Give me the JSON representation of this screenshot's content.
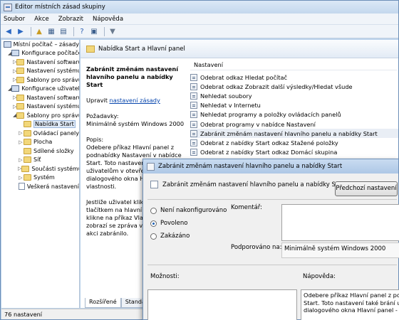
{
  "window": {
    "title": "Editor místních zásad skupiny"
  },
  "menu": [
    "Soubor",
    "Akce",
    "Zobrazit",
    "Nápověda"
  ],
  "tree": [
    {
      "label": "Místní počítač – zásady",
      "icon": "computer-policy-icon",
      "indent": 0,
      "expander": ""
    },
    {
      "label": "Konfigurace počítače",
      "icon": "computer-icon",
      "indent": 1,
      "expander": "◢"
    },
    {
      "label": "Nastavení softwaru",
      "icon": "folder-icon",
      "indent": 2,
      "expander": "▷"
    },
    {
      "label": "Nastavení systému",
      "icon": "folder-icon",
      "indent": 2,
      "expander": "▷"
    },
    {
      "label": "Šablony pro správu",
      "icon": "folder-icon",
      "indent": 2,
      "expander": "▷"
    },
    {
      "label": "Konfigurace uživatele",
      "icon": "computer-icon",
      "indent": 1,
      "expander": "◢"
    },
    {
      "label": "Nastavení softwaru",
      "icon": "folder-icon",
      "indent": 2,
      "expander": "▷"
    },
    {
      "label": "Nastavení systému",
      "icon": "folder-icon",
      "indent": 2,
      "expander": "▷"
    },
    {
      "label": "Šablony pro správu",
      "icon": "folder-icon",
      "indent": 2,
      "expander": "◢"
    },
    {
      "label": "Nabídka Start",
      "icon": "folder-icon",
      "indent": 3,
      "expander": "",
      "selected": true
    },
    {
      "label": "Ovládací panely",
      "icon": "folder-icon",
      "indent": 3,
      "expander": "▷"
    },
    {
      "label": "Plocha",
      "icon": "folder-icon",
      "indent": 3,
      "expander": "▷"
    },
    {
      "label": "Sdílené složky",
      "icon": "folder-icon",
      "indent": 3,
      "expander": ""
    },
    {
      "label": "Síť",
      "icon": "folder-icon",
      "indent": 3,
      "expander": "▷"
    },
    {
      "label": "Součásti systému",
      "icon": "folder-icon",
      "indent": 3,
      "expander": "▷"
    },
    {
      "label": "Systém",
      "icon": "folder-icon",
      "indent": 3,
      "expander": "▷"
    },
    {
      "label": "Veškerá nastavení",
      "icon": "document-icon",
      "indent": 3,
      "expander": ""
    }
  ],
  "pane": {
    "header": "Nabídka Start a Hlavní panel",
    "desc_title": "Zabránit změnám nastavení hlavního panelu a nabídky Start",
    "edit_prefix": "Upravit",
    "edit_link": "nastavení zásady",
    "requirements_label": "Požadavky:",
    "requirements_value": "Minimálně systém Windows 2000",
    "desc_label": "Popis:",
    "desc_text": "Odebere příkaz Hlavní panel z podnabídky Nastavení v nabídce Start. Toto nastavení také brání uživatelům v otevření dialogového okna Hlavní panel - vlastnosti.",
    "desc_text2": "Jestliže uživatel klikne pravým tlačítkem na hlavní panel a pak klikne na příkaz Vlastnosti, zobrazí se zpráva vysvětlující, že akci zabránilo.",
    "list_header": "Nastavení",
    "items": [
      "Odebrat odkaz Hledat počítač",
      "Odebrat odkaz Zobrazit další výsledky/Hledat všude",
      "Nehledat soubory",
      "Nehledat v Internetu",
      "Nehledat programy a položky ovládacích panelů",
      "Odebrat programy v nabídce Nastavení",
      "Zabránit změnám nastavení hlavního panelu a nabídky Start",
      "Odebrat z nabídky Start odkaz Stažené položky",
      "Odebrat z nabídky Start odkaz Domácí skupina"
    ],
    "highlighted_index": 6,
    "tabs": [
      "Rozšířené",
      "Standardní"
    ]
  },
  "status": "76 nastavení",
  "dialog": {
    "title": "Zabránit změnám nastavení hlavního panelu a nabídky Start",
    "policy_name": "Zabránit změnám nastavení hlavního panelu a nabídky Start",
    "prev_button": "Předchozí nastavení",
    "options": [
      "Není nakonfigurováno",
      "Povoleno",
      "Zakázáno"
    ],
    "selected_option": 1,
    "comment_label": "Komentář:",
    "supported_label": "Podporováno na:",
    "supported_value": "Minimálně systém Windows 2000",
    "options_label": "Možnosti:",
    "help_label": "Nápověda:",
    "help_lines": [
      "Odebere příkaz Hlavní panel z podnabídky",
      "Start. Toto nastavení také brání uživatelům",
      "dialogového okna Hlavní panel - vlastnosti"
    ]
  }
}
